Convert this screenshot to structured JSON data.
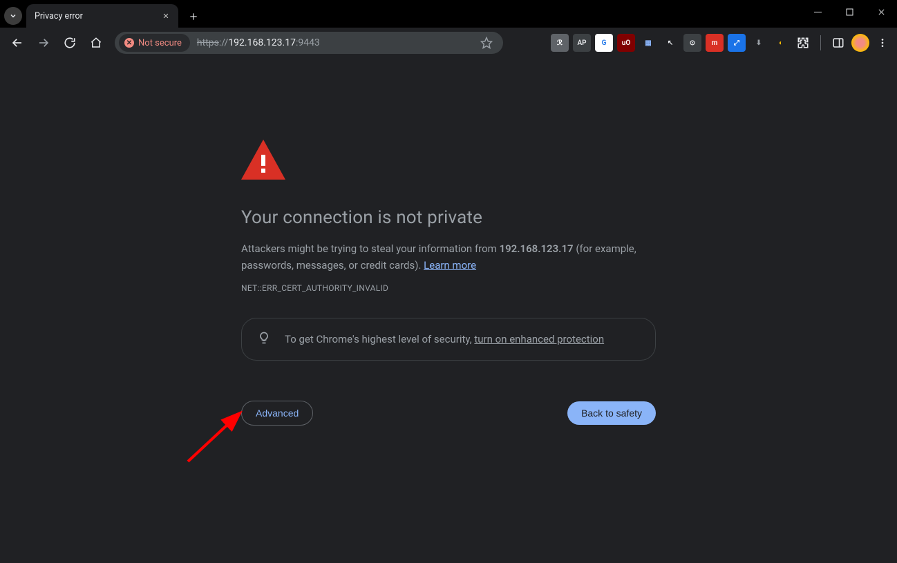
{
  "window": {
    "tab_title": "Privacy error"
  },
  "toolbar": {
    "security_label": "Not secure",
    "url_scheme": "https",
    "url_sep": "://",
    "url_host": "192.168.123.17",
    "url_port": ":9443"
  },
  "page": {
    "heading": "Your connection is not private",
    "body_prefix": "Attackers might be trying to steal your information from ",
    "body_host": "192.168.123.17",
    "body_suffix": " (for example, passwords, messages, or credit cards). ",
    "learn_more": "Learn more",
    "error_code": "NET::ERR_CERT_AUTHORITY_INVALID",
    "tip_prefix": "To get Chrome's highest level of security, ",
    "tip_link": "turn on enhanced protection",
    "advanced_label": "Advanced",
    "back_label": "Back to safety"
  },
  "extensions": [
    {
      "name": "ext-1",
      "glyph": "ℛ",
      "bg": "#5f6368",
      "fg": "#fff"
    },
    {
      "name": "ext-2",
      "glyph": "AP",
      "bg": "#3c4043",
      "fg": "#e8eaed"
    },
    {
      "name": "ext-3",
      "glyph": "G",
      "bg": "#ffffff",
      "fg": "#1a73e8"
    },
    {
      "name": "ext-4",
      "glyph": "uO",
      "bg": "#800000",
      "fg": "#fff"
    },
    {
      "name": "ext-5",
      "glyph": "▦",
      "bg": "transparent",
      "fg": "#8ab4f8"
    },
    {
      "name": "ext-6",
      "glyph": "↖",
      "bg": "transparent",
      "fg": "#e8eaed"
    },
    {
      "name": "ext-7",
      "glyph": "⊙",
      "bg": "#3c4043",
      "fg": "#e8eaed"
    },
    {
      "name": "ext-8",
      "glyph": "m",
      "bg": "#d93025",
      "fg": "#fff"
    },
    {
      "name": "ext-9",
      "glyph": "⤢",
      "bg": "#1a73e8",
      "fg": "#fff"
    },
    {
      "name": "ext-10",
      "glyph": "⬇",
      "bg": "transparent",
      "fg": "#9aa0a6"
    },
    {
      "name": "ext-11",
      "glyph": "◐",
      "bg": "transparent",
      "fg": "#fbbc04"
    }
  ]
}
